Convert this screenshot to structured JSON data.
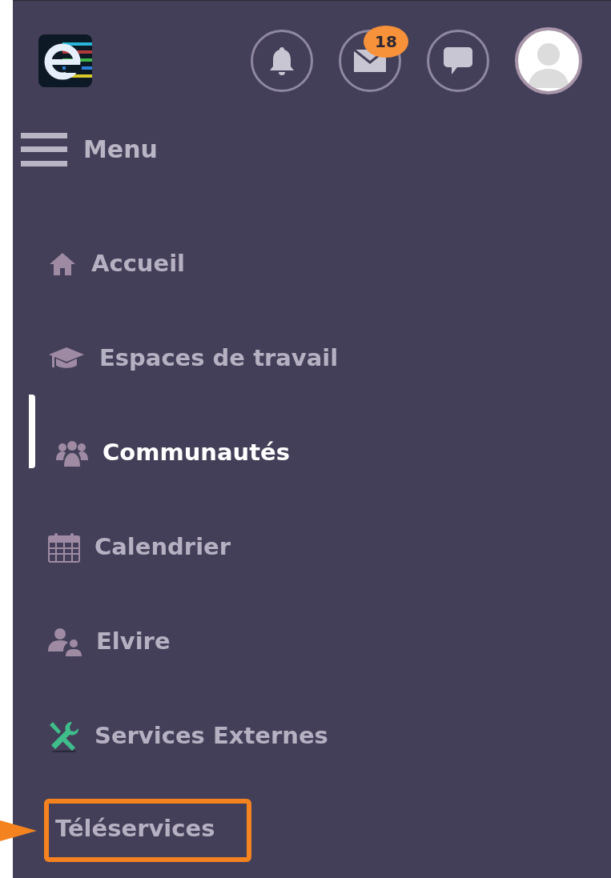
{
  "header": {
    "mail_badge": "18"
  },
  "menu_label": "Menu",
  "items": [
    {
      "label": "Accueil",
      "kind": "home",
      "selected": false,
      "highlighted": false
    },
    {
      "label": "Espaces de travail",
      "kind": "cap",
      "selected": false,
      "highlighted": false
    },
    {
      "label": "Communautés",
      "kind": "group",
      "selected": true,
      "highlighted": false
    },
    {
      "label": "Calendrier",
      "kind": "calendar",
      "selected": false,
      "highlighted": false
    },
    {
      "label": "Elvire",
      "kind": "users",
      "selected": false,
      "highlighted": false
    },
    {
      "label": "Services Externes",
      "kind": "tools",
      "selected": false,
      "highlighted": false
    },
    {
      "label": "Téléservices",
      "kind": "plain",
      "selected": false,
      "highlighted": true
    }
  ]
}
